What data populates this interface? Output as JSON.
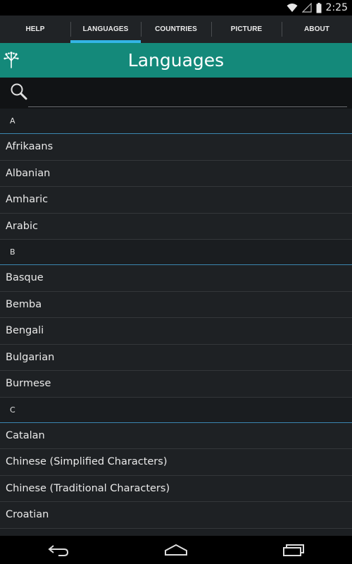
{
  "status": {
    "time": "2:25"
  },
  "tabs": [
    {
      "label": "HELP",
      "active": false
    },
    {
      "label": "LANGUAGES",
      "active": true
    },
    {
      "label": "COUNTRIES",
      "active": false
    },
    {
      "label": "PICTURE",
      "active": false
    },
    {
      "label": "ABOUT",
      "active": false
    }
  ],
  "header": {
    "title": "Languages"
  },
  "search": {
    "value": "",
    "placeholder": ""
  },
  "sections": [
    {
      "letter": "A",
      "items": [
        "Afrikaans",
        "Albanian",
        "Amharic",
        "Arabic"
      ]
    },
    {
      "letter": "B",
      "items": [
        "Basque",
        "Bemba",
        "Bengali",
        "Bulgarian",
        "Burmese"
      ]
    },
    {
      "letter": "C",
      "items": [
        "Catalan",
        "Chinese (Simplified Characters)",
        "Chinese (Traditional Characters)",
        "Croatian"
      ]
    }
  ],
  "colors": {
    "accent": "#33b5e5",
    "title_bar": "#14897a",
    "background": "#1c1f22"
  }
}
